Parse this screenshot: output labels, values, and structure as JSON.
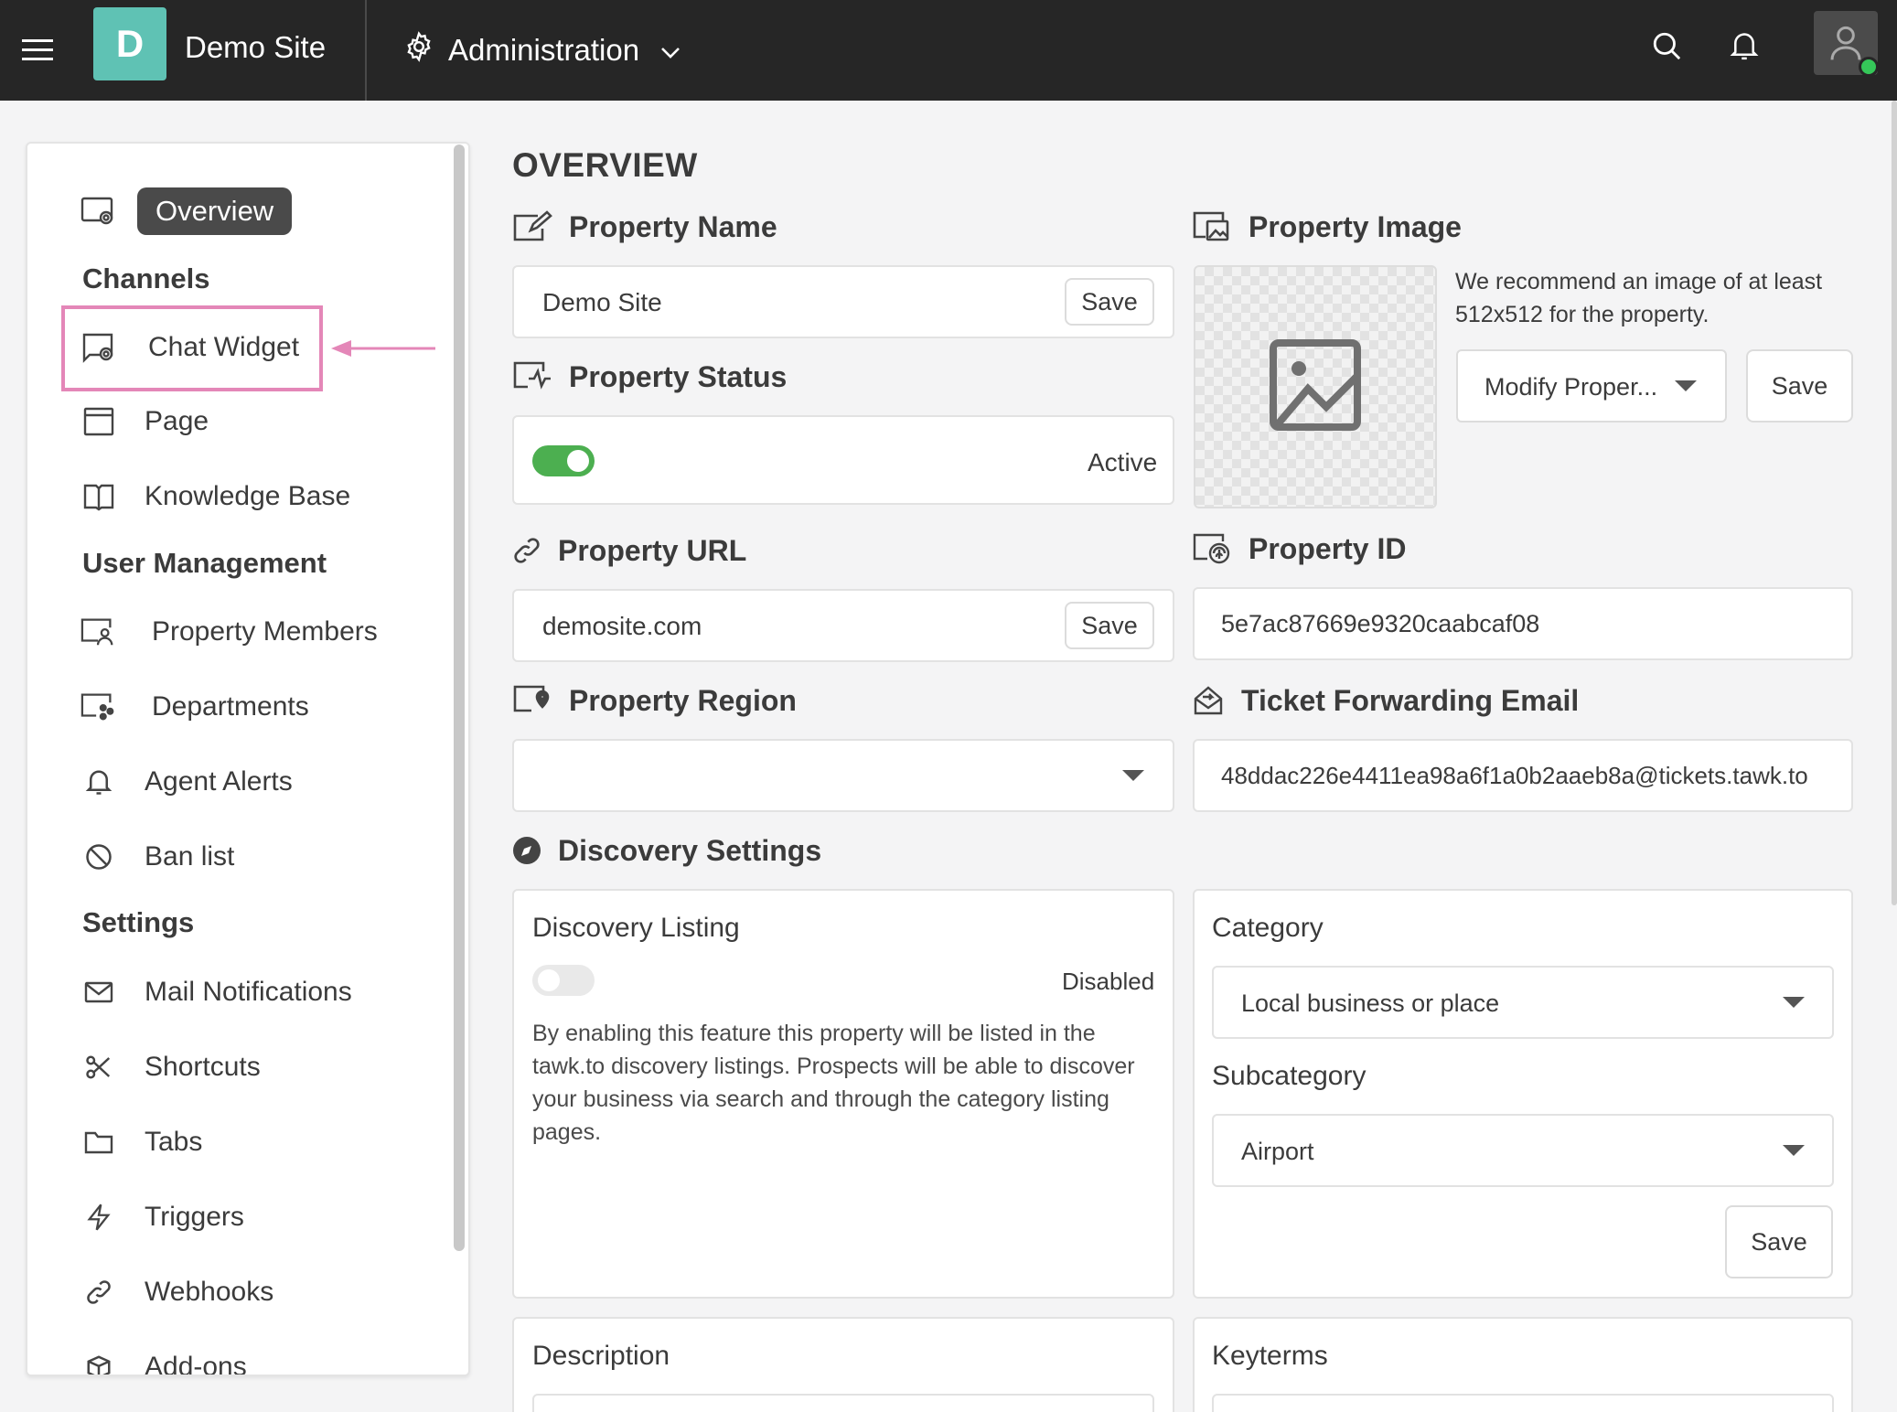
{
  "topbar": {
    "logo_letter": "D",
    "site_name": "Demo Site",
    "section": "Administration"
  },
  "sidebar": {
    "overview": "Overview",
    "channels_heading": "Channels",
    "channels": [
      "Chat Widget",
      "Page",
      "Knowledge Base"
    ],
    "user_mgmt_heading": "User Management",
    "user_mgmt": [
      "Property Members",
      "Departments",
      "Agent Alerts",
      "Ban list"
    ],
    "settings_heading": "Settings",
    "settings": [
      "Mail Notifications",
      "Shortcuts",
      "Tabs",
      "Triggers",
      "Webhooks",
      "Add-ons"
    ]
  },
  "main": {
    "title": "OVERVIEW",
    "property_name": {
      "label": "Property Name",
      "value": "Demo Site",
      "save": "Save"
    },
    "property_status": {
      "label": "Property Status",
      "status": "Active",
      "enabled": true
    },
    "property_url": {
      "label": "Property URL",
      "value": "demosite.com",
      "save": "Save"
    },
    "property_region": {
      "label": "Property Region",
      "value": ""
    },
    "property_image": {
      "label": "Property Image",
      "hint": "We recommend an image of at least 512x512 for the property.",
      "modify": "Modify Proper...",
      "save": "Save"
    },
    "property_id": {
      "label": "Property ID",
      "value": "5e7ac87669e9320caabcaf08"
    },
    "ticket_email": {
      "label": "Ticket Forwarding Email",
      "value": "48ddac226e4411ea98a6f1a0b2aaeb8a@tickets.tawk.to"
    },
    "discovery": {
      "label": "Discovery Settings",
      "listing_title": "Discovery Listing",
      "listing_status": "Disabled",
      "listing_enabled": false,
      "listing_desc": "By enabling this feature this property will be listed in the tawk.to discovery listings. Prospects will be able to discover your business via search and through the category listing pages.",
      "category_label": "Category",
      "category_value": "Local business or place",
      "subcategory_label": "Subcategory",
      "subcategory_value": "Airport",
      "save": "Save"
    },
    "description_title": "Description",
    "keyterms_title": "Keyterms"
  },
  "colors": {
    "topbar": "#262626",
    "logo": "#5fc2b4",
    "toggle_on": "#4caf50",
    "highlight": "#e487b8"
  }
}
